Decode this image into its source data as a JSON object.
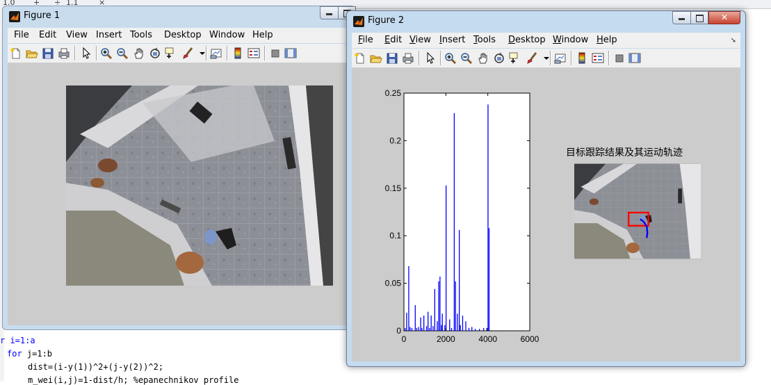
{
  "editor": {
    "top_fragments": [
      "1.0",
      "+",
      "÷",
      "1.1",
      "×"
    ],
    "code_lines": [
      {
        "segments": [
          {
            "text": "r i=1:a",
            "kind": "kw-part"
          }
        ]
      },
      {
        "segments": [
          {
            "text": "for",
            "kind": "kw"
          },
          {
            "text": " j=1:b",
            "kind": "plain"
          }
        ]
      },
      {
        "segments": [
          {
            "text": "dist=(i-y(1))^2+(j-y(2))^2;",
            "kind": "plain"
          }
        ]
      },
      {
        "segments": [
          {
            "text": "m_wei(i,j)=1-dist/h; %epanechnikov profile",
            "kind": "plain"
          }
        ]
      }
    ]
  },
  "figure1": {
    "title": "Figure 1",
    "menu": [
      "File",
      "Edit",
      "View",
      "Insert",
      "Tools",
      "Desktop",
      "Window",
      "Help"
    ],
    "toolbar_icons": [
      "new-file-icon",
      "open-folder-icon",
      "save-icon",
      "print-icon",
      "pointer-icon",
      "zoom-in-icon",
      "zoom-out-icon",
      "pan-hand-icon",
      "rotate-3d-icon",
      "data-cursor-icon",
      "brush-icon",
      "dropdown-icon",
      "link-plot-icon",
      "colorbar-icon",
      "legend-icon",
      "hide-plot-tools-icon",
      "show-plot-tools-icon"
    ]
  },
  "figure2": {
    "title": "Figure 2",
    "menu": [
      {
        "label": "File",
        "underline": 0
      },
      {
        "label": "Edit",
        "underline": 0
      },
      {
        "label": "View",
        "underline": 0
      },
      {
        "label": "Insert",
        "underline": 0
      },
      {
        "label": "Tools",
        "underline": 0
      },
      {
        "label": "Desktop",
        "underline": 0
      },
      {
        "label": "Window",
        "underline": 0
      },
      {
        "label": "Help",
        "underline": 0
      }
    ],
    "toolbar_icons": [
      "new-file-icon",
      "open-folder-icon",
      "save-icon",
      "print-icon",
      "pointer-icon",
      "zoom-in-icon",
      "zoom-out-icon",
      "pan-hand-icon",
      "rotate-3d-icon",
      "data-cursor-icon",
      "brush-icon",
      "dropdown-icon",
      "link-plot-icon",
      "colorbar-icon",
      "legend-icon",
      "hide-plot-tools-icon",
      "show-plot-tools-icon"
    ],
    "image_title": "目标跟踪结果及其运动轨迹"
  },
  "chart_data": {
    "type": "bar",
    "title": "",
    "xlabel": "",
    "ylabel": "",
    "xlim": [
      0,
      6000
    ],
    "ylim": [
      0,
      0.25
    ],
    "xticks": [
      "0",
      "2000",
      "4000",
      "6000"
    ],
    "yticks": [
      "0",
      "0.05",
      "0.1",
      "0.15",
      "0.2",
      "0.25"
    ],
    "color": "#0000ff",
    "grid": false,
    "x": [
      60,
      130,
      230,
      290,
      380,
      540,
      610,
      700,
      800,
      860,
      950,
      1080,
      1150,
      1230,
      1300,
      1390,
      1470,
      1590,
      1660,
      1720,
      1790,
      1830,
      1950,
      2010,
      2180,
      2270,
      2400,
      2460,
      2550,
      2640,
      2690,
      2800,
      2950,
      3100,
      3240,
      3400,
      3600,
      3800,
      3950,
      4010,
      4060
    ],
    "values": [
      0.003,
      0.019,
      0.068,
      0.004,
      0.003,
      0.027,
      0.003,
      0.004,
      0.014,
      0.003,
      0.016,
      0.005,
      0.02,
      0.003,
      0.016,
      0.005,
      0.044,
      0.01,
      0.052,
      0.057,
      0.006,
      0.018,
      0.006,
      0.153,
      0.012,
      0.003,
      0.229,
      0.052,
      0.018,
      0.106,
      0.006,
      0.016,
      0.01,
      0.003,
      0.004,
      0.002,
      0.002,
      0.003,
      0.003,
      0.238,
      0.108
    ]
  }
}
